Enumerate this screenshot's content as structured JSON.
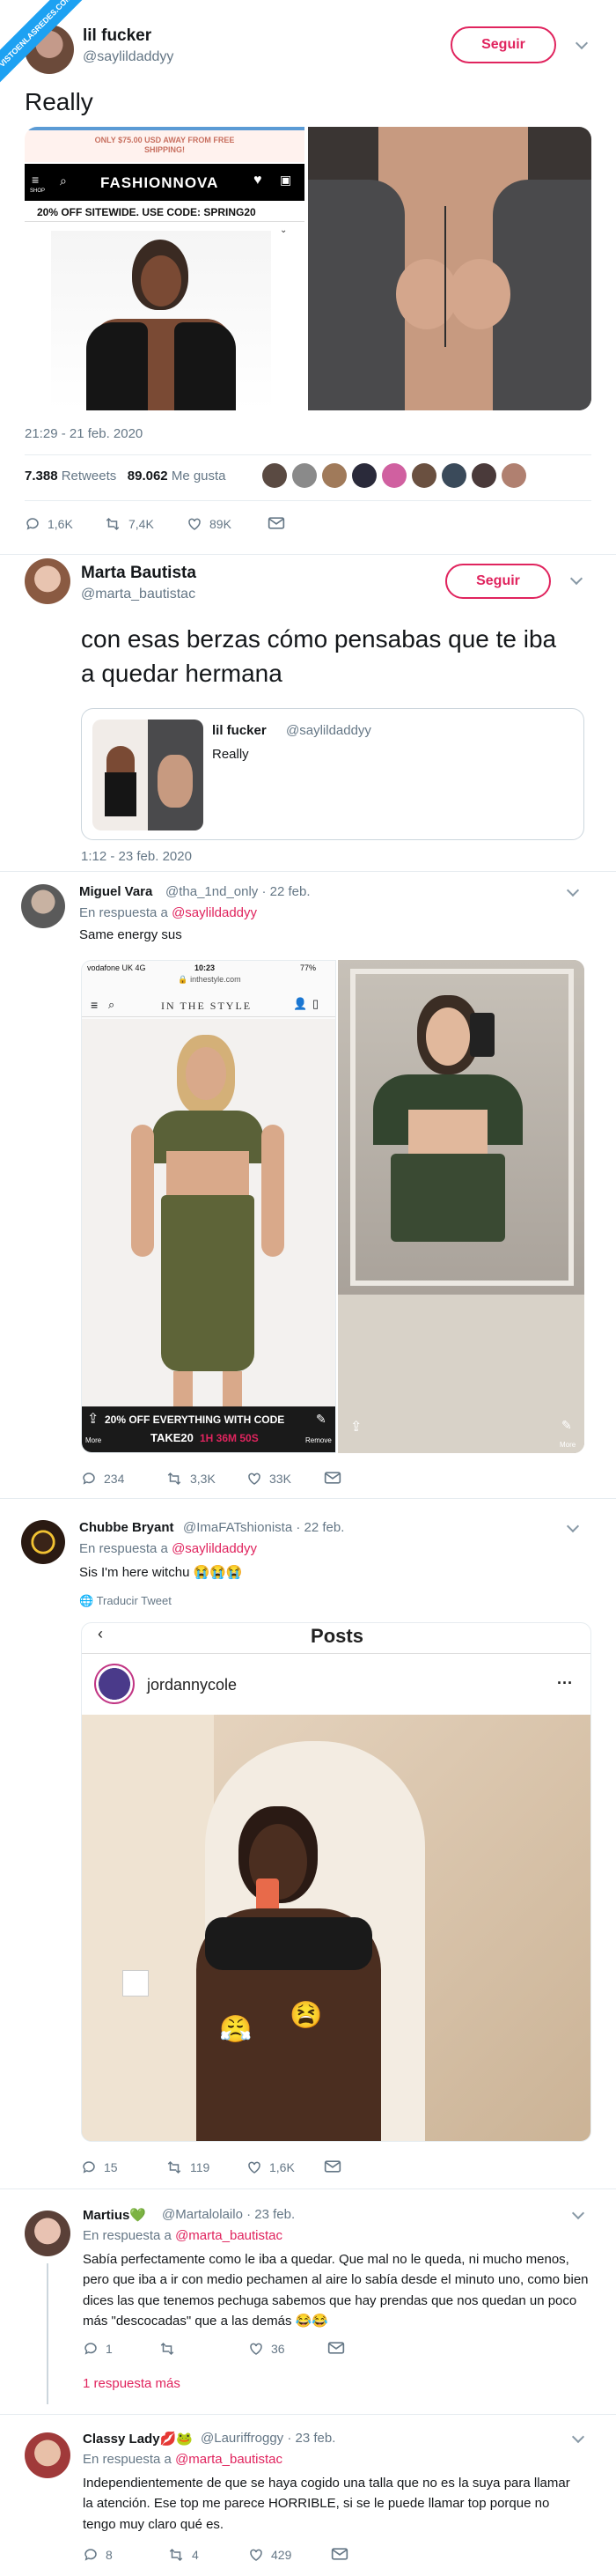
{
  "watermark": {
    "text": "VISTOENLASREDES.COM"
  },
  "tweet1": {
    "name": "lil fucker",
    "handle": "@saylildaddyy",
    "follow_label": "Seguir",
    "text": "Really",
    "shop": {
      "promo_top": "ONLY $75.00 USD AWAY FROM FREE SHIPPING!",
      "brand": "FASHIONNOVA",
      "menu_label": "SHOP",
      "sale_banner": "20% OFF SITEWIDE. USE CODE: SPRING20"
    },
    "timestamp": "21:29 - 21 feb. 2020",
    "retweets_count": "7.388",
    "retweets_label": "Retweets",
    "likes_count": "89.062",
    "likes_label": "Me gusta",
    "actions": {
      "reply": "1,6K",
      "retweet": "7,4K",
      "like": "89K"
    }
  },
  "tweet2": {
    "name": "Marta Bautista",
    "handle": "@marta_bautistac",
    "follow_label": "Seguir",
    "text": "con esas berzas cómo pensabas que te iba a quedar hermana",
    "quote": {
      "name": "lil fucker",
      "handle": "@saylildaddyy",
      "text": "Really"
    },
    "timestamp": "1:12 - 23 feb. 2020"
  },
  "reply1": {
    "name": "Miguel Vara",
    "handle": "@tha_1nd_only · 22 feb.",
    "replying_prefix": "En respuesta a",
    "replying_to": "@saylildaddyy",
    "text": "Same energy sus",
    "phone": {
      "carrier": "vodafone UK  4G",
      "time": "10:23",
      "battery": "77%",
      "url": "inthestyle.com",
      "brand": "IN THE STYLE",
      "banner": "20% OFF EVERYTHING WITH CODE",
      "code": "TAKE20",
      "countdown": "1H 36M 50S",
      "more_left": "More",
      "remove_label": "Remove",
      "more_right": "More"
    },
    "actions": {
      "reply": "234",
      "retweet": "3,3K",
      "like": "33K"
    }
  },
  "reply2": {
    "name": "Chubbe Bryant",
    "handle": "@ImaFATshionista · 22 feb.",
    "replying_prefix": "En respuesta a",
    "replying_to": "@saylildaddyy",
    "text": "Sis I'm here witchu 😭😭😭",
    "translate": "Traducir Tweet",
    "embed": {
      "header": "Posts",
      "username": "jordannycole",
      "more": "···"
    },
    "actions": {
      "reply": "15",
      "retweet": "119",
      "like": "1,6K"
    }
  },
  "reply3": {
    "name": "Martius💚",
    "handle": "@Martalolailo · 23 feb.",
    "replying_prefix": "En respuesta a",
    "replying_to": "@marta_bautistac",
    "text": "Sabía perfectamente como le iba a quedar. Que mal no le queda, ni mucho menos, pero que iba a ir con medio pechamen al aire lo sabía desde el minuto uno, como bien dices las que tenemos pechuga sabemos que hay prendas que nos quedan un poco más \"descocadas\" que a las demás 😂😂",
    "actions": {
      "reply": "1",
      "retweet": "",
      "like": "36"
    },
    "more_replies": "1 respuesta más"
  },
  "reply4": {
    "name": "Classy Lady💋🐸",
    "handle": "@Lauriffroggy · 23 feb.",
    "replying_prefix": "En respuesta a",
    "replying_to": "@marta_bautistac",
    "text": "Independientemente de que se haya cogido una talla que no es la suya para llamar la atención. Ese top me parece HORRIBLE, si se le puede llamar top porque no tengo muy claro qué es.",
    "actions": {
      "reply": "8",
      "retweet": "4",
      "like": "429"
    }
  },
  "colors": {
    "accent": "#e0245e",
    "text": "#14171a",
    "muted": "#657786",
    "border": "#e6ecf0",
    "link": "#1da1f2"
  }
}
